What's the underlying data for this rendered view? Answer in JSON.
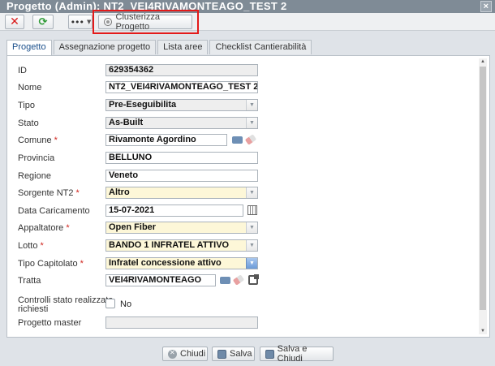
{
  "window": {
    "title": "Progetto (Admin): NT2_VEI4RIVAMONTEAGO_TEST 2"
  },
  "toolbar": {
    "menu_label": "•••",
    "clusterizza_label": "Clusterizza Progetto"
  },
  "tabs": [
    {
      "label": "Progetto"
    },
    {
      "label": "Assegnazione progetto"
    },
    {
      "label": "Lista aree"
    },
    {
      "label": "Checklist Cantierabilità"
    }
  ],
  "form": {
    "id": {
      "label": "ID",
      "value": "629354362"
    },
    "nome": {
      "label": "Nome",
      "value": "NT2_VEI4RIVAMONTEAGO_TEST 2"
    },
    "tipo": {
      "label": "Tipo",
      "value": "Pre-Eseguibilita"
    },
    "stato": {
      "label": "Stato",
      "value": "As-Built"
    },
    "comune": {
      "label": "Comune",
      "value": "Rivamonte Agordino"
    },
    "provincia": {
      "label": "Provincia",
      "value": "BELLUNO"
    },
    "regione": {
      "label": "Regione",
      "value": "Veneto"
    },
    "sorgente": {
      "label": "Sorgente NT2",
      "value": "Altro"
    },
    "data_caricamento": {
      "label": "Data Caricamento",
      "value": "15-07-2021"
    },
    "appaltatore": {
      "label": "Appaltatore",
      "value": "Open Fiber"
    },
    "lotto": {
      "label": "Lotto",
      "value": "BANDO 1 INFRATEL ATTIVO"
    },
    "tipo_capitolato": {
      "label": "Tipo Capitolato",
      "value": "Infratel concessione attivo"
    },
    "tratta": {
      "label": "Tratta",
      "value": "VEI4RIVAMONTEAGO"
    },
    "controlli": {
      "label_line1": "Controlli stato realizzato",
      "label_line2": "richiesti",
      "value": "No"
    },
    "progetto_master": {
      "label": "Progetto master",
      "value": ""
    },
    "required_mark": "*"
  },
  "footer": {
    "close_label": "Chiudi",
    "save_label": "Salva",
    "save_close_label": "Salva e Chiudi"
  },
  "colors": {
    "highlight": "#e41a1a",
    "required_bg": "#fdf7d8",
    "tab_active_text": "#1a4f8b"
  }
}
